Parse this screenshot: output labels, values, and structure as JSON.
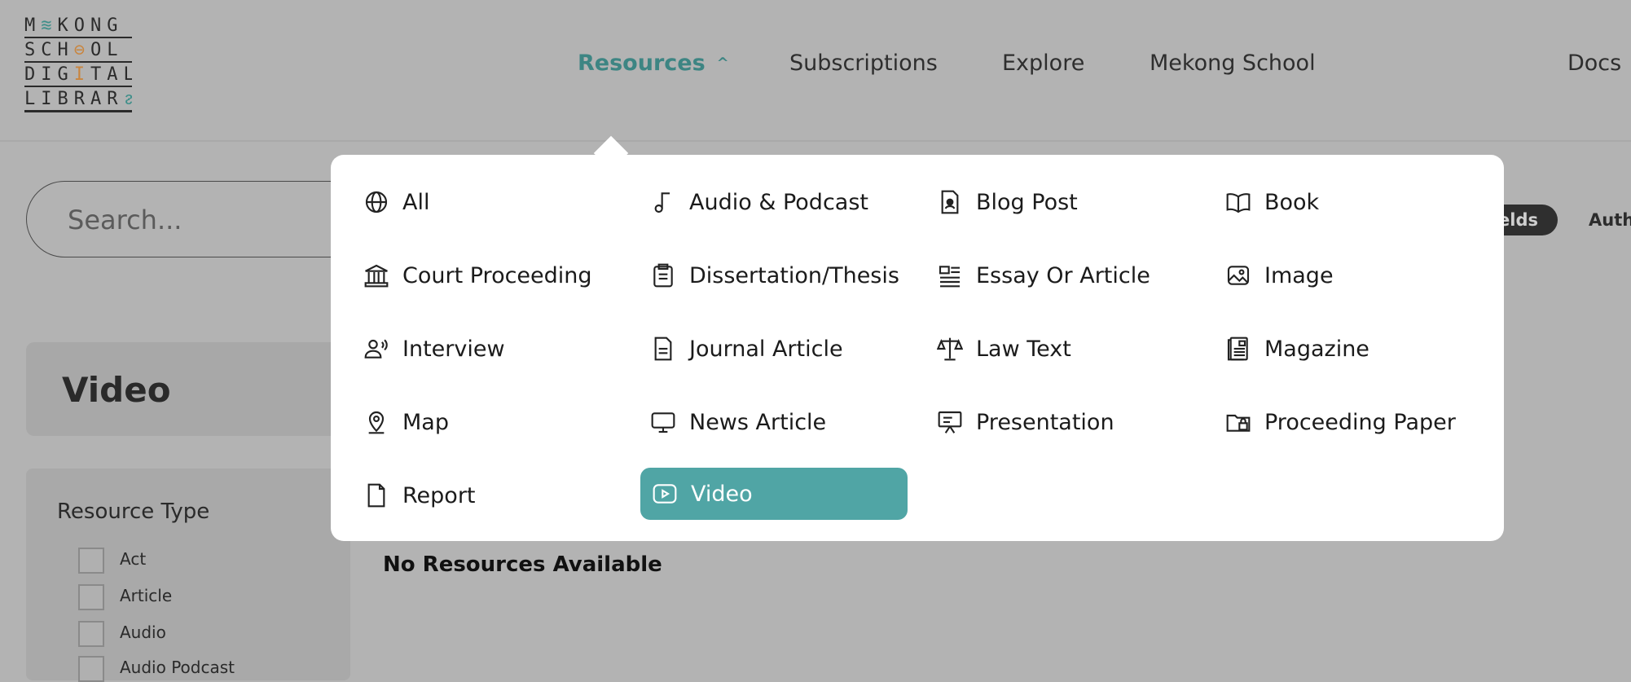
{
  "logo": {
    "rows": [
      {
        "a": "M",
        "b": "≋",
        "c": "KONG"
      },
      {
        "a": "SCH",
        "b": "⊖",
        "c": "OL"
      },
      {
        "a": "DIG",
        "b": "I",
        "c": "TAL"
      },
      {
        "a": "LIBRAR",
        "b": "ᴤ",
        "c": ""
      }
    ]
  },
  "nav": {
    "resources": "Resources",
    "subscriptions": "Subscriptions",
    "explore": "Explore",
    "mekong_school": "Mekong School",
    "docs": "Docs"
  },
  "search": {
    "placeholder": "Search..."
  },
  "fields_pill": "elds",
  "auth_tab": "Auth",
  "page_title": "Video",
  "filters": {
    "title": "Resource Type",
    "options": [
      "Act",
      "Article",
      "Audio",
      "Audio Podcast"
    ]
  },
  "empty_message": "No Resources Available",
  "menu": {
    "items": [
      {
        "label": "All",
        "icon": "globe-icon"
      },
      {
        "label": "Audio & Podcast",
        "icon": "music-note-icon"
      },
      {
        "label": "Blog Post",
        "icon": "blog-icon"
      },
      {
        "label": "Book",
        "icon": "book-icon"
      },
      {
        "label": "Court Proceeding",
        "icon": "courthouse-icon"
      },
      {
        "label": "Dissertation/Thesis",
        "icon": "clipboard-icon"
      },
      {
        "label": "Essay Or Article",
        "icon": "article-icon"
      },
      {
        "label": "Image",
        "icon": "image-icon"
      },
      {
        "label": "Interview",
        "icon": "interview-icon"
      },
      {
        "label": "Journal Article",
        "icon": "document-icon"
      },
      {
        "label": "Law Text",
        "icon": "scales-icon"
      },
      {
        "label": "Magazine",
        "icon": "magazine-icon"
      },
      {
        "label": "Map",
        "icon": "map-pin-icon"
      },
      {
        "label": "News Article",
        "icon": "monitor-icon"
      },
      {
        "label": "Presentation",
        "icon": "presentation-icon"
      },
      {
        "label": "Proceeding Paper",
        "icon": "folder-lock-icon"
      },
      {
        "label": "Report",
        "icon": "file-icon"
      },
      {
        "label": "Video",
        "icon": "play-icon",
        "selected": true
      }
    ]
  },
  "colors": {
    "accent": "#50a5a5",
    "nav_active": "#3d8583"
  }
}
